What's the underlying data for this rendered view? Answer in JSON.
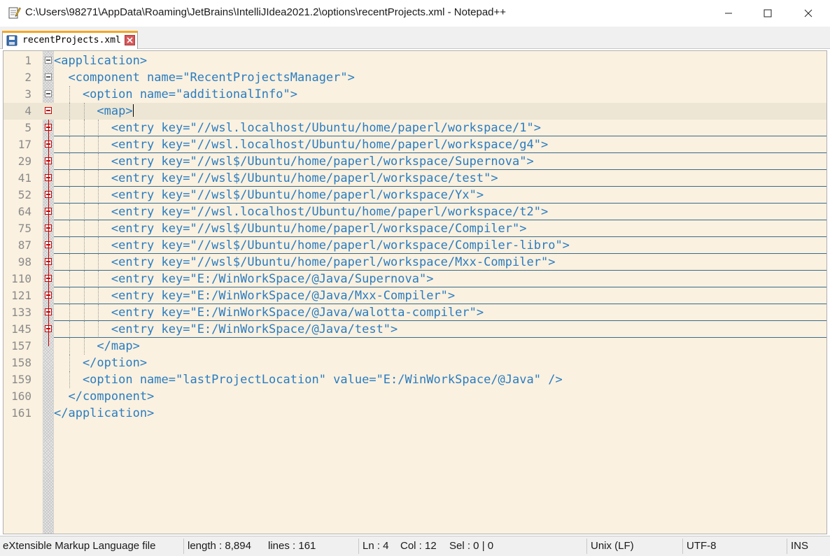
{
  "window": {
    "title": "C:\\Users\\98271\\AppData\\Roaming\\JetBrains\\IntelliJIdea2021.2\\options\\recentProjects.xml - Notepad++",
    "minimize_glyph": "—",
    "maximize_glyph": "☐",
    "close_glyph": "✕"
  },
  "tab": {
    "label": "recentProjects.xml",
    "close_glyph": "×"
  },
  "lines": [
    {
      "num": "1",
      "text": "<application>"
    },
    {
      "num": "2",
      "text": "  <component name=\"RecentProjectsManager\">"
    },
    {
      "num": "3",
      "text": "    <option name=\"additionalInfo\">"
    },
    {
      "num": "4",
      "text": "      <map>"
    },
    {
      "num": "5",
      "text": "        <entry key=\"//wsl.localhost/Ubuntu/home/paperl/workspace/1\">"
    },
    {
      "num": "17",
      "text": "        <entry key=\"//wsl.localhost/Ubuntu/home/paperl/workspace/g4\">"
    },
    {
      "num": "29",
      "text": "        <entry key=\"//wsl$/Ubuntu/home/paperl/workspace/Supernova\">"
    },
    {
      "num": "41",
      "text": "        <entry key=\"//wsl$/Ubuntu/home/paperl/workspace/test\">"
    },
    {
      "num": "52",
      "text": "        <entry key=\"//wsl$/Ubuntu/home/paperl/workspace/Yx\">"
    },
    {
      "num": "64",
      "text": "        <entry key=\"//wsl.localhost/Ubuntu/home/paperl/workspace/t2\">"
    },
    {
      "num": "75",
      "text": "        <entry key=\"//wsl$/Ubuntu/home/paperl/workspace/Compiler\">"
    },
    {
      "num": "87",
      "text": "        <entry key=\"//wsl$/Ubuntu/home/paperl/workspace/Compiler-libro\">"
    },
    {
      "num": "98",
      "text": "        <entry key=\"//wsl$/Ubuntu/home/paperl/workspace/Mxx-Compiler\">"
    },
    {
      "num": "110",
      "text": "        <entry key=\"E:/WinWorkSpace/@Java/Supernova\">"
    },
    {
      "num": "121",
      "text": "        <entry key=\"E:/WinWorkSpace/@Java/Mxx-Compiler\">"
    },
    {
      "num": "133",
      "text": "        <entry key=\"E:/WinWorkSpace/@Java/walotta-compiler\">"
    },
    {
      "num": "145",
      "text": "        <entry key=\"E:/WinWorkSpace/@Java/test\">"
    },
    {
      "num": "157",
      "text": "      </map>"
    },
    {
      "num": "158",
      "text": "    </option>"
    },
    {
      "num": "159",
      "text": "    <option name=\"lastProjectLocation\" value=\"E:/WinWorkSpace/@Java\" />"
    },
    {
      "num": "160",
      "text": "  </component>"
    },
    {
      "num": "161",
      "text": "</application>"
    }
  ],
  "status": {
    "language": "eXtensible Markup Language file",
    "length": "length : 8,894",
    "lines": "lines : 161",
    "ln": "Ln : 4",
    "col": "Col : 12",
    "sel": "Sel : 0 | 0",
    "eol": "Unix (LF)",
    "encoding": "UTF-8",
    "mode": "INS"
  },
  "colors": {
    "editor_bg": "#faf1e0",
    "tag_color": "#2a7cc0",
    "fold_red": "#c00000",
    "tab_accent": "#f5a623"
  }
}
